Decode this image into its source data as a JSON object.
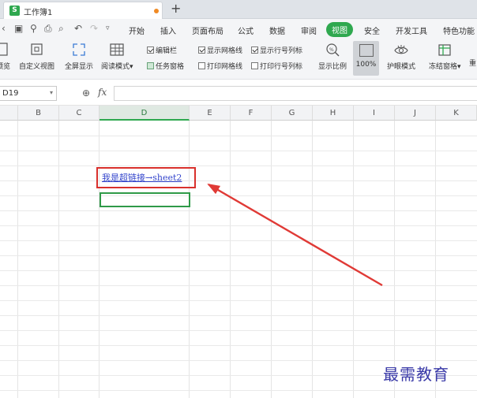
{
  "tab": {
    "title": "工作簿1",
    "logo": "S"
  },
  "menu": [
    "开始",
    "插入",
    "页面布局",
    "公式",
    "数据",
    "审阅",
    "视图",
    "安全",
    "开发工具",
    "特色功能"
  ],
  "menu_active": "视图",
  "ribbon": {
    "btn_preview": "预览",
    "btn_custom_view": "自定义视图",
    "btn_fullscreen": "全屏显示",
    "btn_reading": "阅读模式",
    "chk_edit_bar": "编辑栏",
    "chk_task_pane": "任务窗格",
    "chk_show_grid": "显示网格线",
    "chk_print_grid": "打印网格线",
    "chk_show_headers": "显示行号列标",
    "chk_print_headers": "打印行号列标",
    "btn_zoom_ratio": "显示比例",
    "btn_100": "100%",
    "btn_eye_mode": "护眼模式",
    "btn_freeze": "冻结窗格",
    "btn_more": "重"
  },
  "formula": {
    "namebox": "D19",
    "fx": "fx",
    "content": ""
  },
  "columns": [
    "B",
    "C",
    "D",
    "E",
    "F",
    "G",
    "H",
    "I",
    "J",
    "K"
  ],
  "selected_column": "D",
  "cell_link_text": "我是超链接→sheet2",
  "watermark": "最需教育",
  "colors": {
    "accent": "#2fa84f",
    "link": "#3344cc",
    "annotation": "#d9302c"
  }
}
